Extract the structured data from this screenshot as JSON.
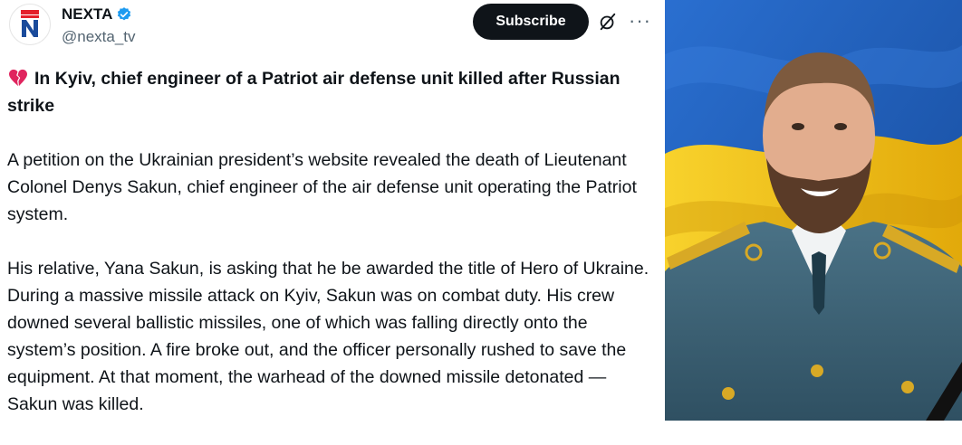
{
  "author": {
    "name": "NEXTA",
    "handle": "@nexta_tv"
  },
  "header": {
    "subscribe_label": "Subscribe",
    "icons": [
      "grok-icon",
      "more-icon"
    ],
    "more_label": "···"
  },
  "post": {
    "headline": "In Kyiv, chief engineer of a Patriot air defense unit killed after Russian strike",
    "paragraphs": [
      "A petition on the Ukrainian president’s website revealed the death of Lieutenant Colonel Denys Sakun, chief engineer of the air defense unit operating the Patriot system.",
      "His relative, Yana Sakun, is asking that he be awarded the title of Hero of Ukraine. During a massive missile attack on Kyiv, Sakun was on combat duty. His crew downed several ballistic missiles, one of which was falling directly onto the system’s position. A fire broke out, and the officer personally rushed to save the equipment. At that moment, the warhead of the downed missile detonated — Sakun was killed."
    ]
  },
  "colors": {
    "text": "#0f1419",
    "secondary": "#536471",
    "verified": "#1d9bf0",
    "nexta_red": "#e4202a",
    "nexta_blue": "#1a4b9b",
    "flag_blue": "#1f5fbf",
    "flag_yellow": "#f5c518",
    "uniform": "#3e6478"
  }
}
